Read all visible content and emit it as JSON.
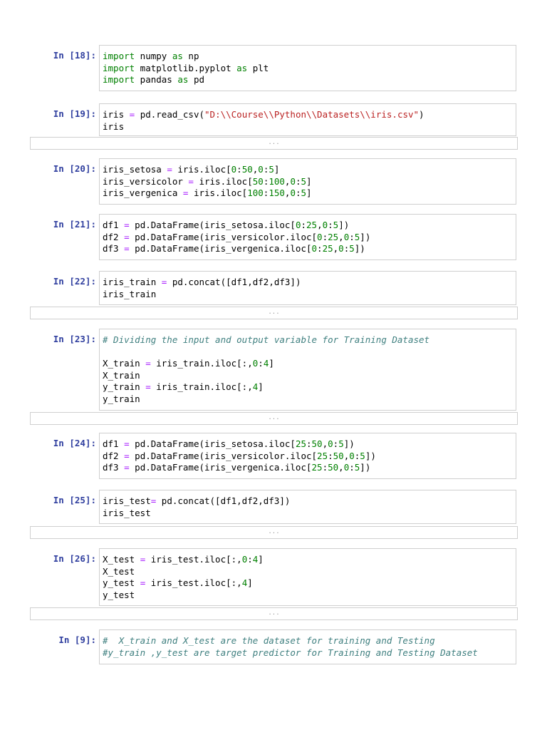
{
  "cells": [
    {
      "prompt": "In [18]:",
      "lines": [
        [
          [
            "import",
            "k"
          ],
          [
            " numpy ",
            ""
          ],
          [
            "as",
            "k"
          ],
          [
            " np",
            ""
          ]
        ],
        [
          [
            "import",
            "k"
          ],
          [
            " matplotlib.pyplot ",
            ""
          ],
          [
            "as",
            "k"
          ],
          [
            " plt",
            ""
          ]
        ],
        [
          [
            "import",
            "k"
          ],
          [
            " pandas ",
            ""
          ],
          [
            "as",
            "k"
          ],
          [
            " pd",
            ""
          ]
        ]
      ],
      "output": null
    },
    {
      "prompt": "In [19]:",
      "lines": [
        [
          [
            "iris ",
            ""
          ],
          [
            "=",
            "o"
          ],
          [
            " pd.read_csv(",
            ""
          ],
          [
            "\"D:\\\\Course\\\\Python\\\\Datasets\\\\iris.csv\"",
            "s"
          ],
          [
            ")",
            ""
          ]
        ],
        [
          [
            "iris",
            ""
          ]
        ]
      ],
      "output": "..."
    },
    {
      "prompt": "In [20]:",
      "lines": [
        [
          [
            "iris_setosa ",
            ""
          ],
          [
            "=",
            "o"
          ],
          [
            " iris.iloc[",
            ""
          ],
          [
            "0",
            "n"
          ],
          [
            ":",
            ""
          ],
          [
            "50",
            "n"
          ],
          [
            ",",
            ""
          ],
          [
            "0",
            "n"
          ],
          [
            ":",
            ""
          ],
          [
            "5",
            "n"
          ],
          [
            "]",
            ""
          ]
        ],
        [
          [
            "iris_versicolor ",
            ""
          ],
          [
            "=",
            "o"
          ],
          [
            " iris.iloc[",
            ""
          ],
          [
            "50",
            "n"
          ],
          [
            ":",
            ""
          ],
          [
            "100",
            "n"
          ],
          [
            ",",
            ""
          ],
          [
            "0",
            "n"
          ],
          [
            ":",
            ""
          ],
          [
            "5",
            "n"
          ],
          [
            "]",
            ""
          ]
        ],
        [
          [
            "iris_vergenica ",
            ""
          ],
          [
            "=",
            "o"
          ],
          [
            " iris.iloc[",
            ""
          ],
          [
            "100",
            "n"
          ],
          [
            ":",
            ""
          ],
          [
            "150",
            "n"
          ],
          [
            ",",
            ""
          ],
          [
            "0",
            "n"
          ],
          [
            ":",
            ""
          ],
          [
            "5",
            "n"
          ],
          [
            "]",
            ""
          ]
        ]
      ],
      "output": null
    },
    {
      "prompt": "In [21]:",
      "lines": [
        [
          [
            "df1 ",
            ""
          ],
          [
            "=",
            "o"
          ],
          [
            " pd.DataFrame(iris_setosa.iloc[",
            ""
          ],
          [
            "0",
            "n"
          ],
          [
            ":",
            ""
          ],
          [
            "25",
            "n"
          ],
          [
            ",",
            ""
          ],
          [
            "0",
            "n"
          ],
          [
            ":",
            ""
          ],
          [
            "5",
            "n"
          ],
          [
            "])",
            ""
          ]
        ],
        [
          [
            "df2 ",
            ""
          ],
          [
            "=",
            "o"
          ],
          [
            " pd.DataFrame(iris_versicolor.iloc[",
            ""
          ],
          [
            "0",
            "n"
          ],
          [
            ":",
            ""
          ],
          [
            "25",
            "n"
          ],
          [
            ",",
            ""
          ],
          [
            "0",
            "n"
          ],
          [
            ":",
            ""
          ],
          [
            "5",
            "n"
          ],
          [
            "])",
            ""
          ]
        ],
        [
          [
            "df3 ",
            ""
          ],
          [
            "=",
            "o"
          ],
          [
            " pd.DataFrame(iris_vergenica.iloc[",
            ""
          ],
          [
            "0",
            "n"
          ],
          [
            ":",
            ""
          ],
          [
            "25",
            "n"
          ],
          [
            ",",
            ""
          ],
          [
            "0",
            "n"
          ],
          [
            ":",
            ""
          ],
          [
            "5",
            "n"
          ],
          [
            "])",
            ""
          ]
        ]
      ],
      "output": null
    },
    {
      "prompt": "In [22]:",
      "lines": [
        [
          [
            "iris_train ",
            ""
          ],
          [
            "=",
            "o"
          ],
          [
            " pd.concat([df1,df2,df3])",
            ""
          ]
        ],
        [
          [
            "iris_train",
            ""
          ]
        ]
      ],
      "output": "..."
    },
    {
      "prompt": "In [23]:",
      "lines": [
        [
          [
            "# Dividing the input and output variable for Training Dataset",
            "c"
          ]
        ],
        [],
        [
          [
            "X_train ",
            ""
          ],
          [
            "=",
            "o"
          ],
          [
            " iris_train.iloc[:,",
            ""
          ],
          [
            "0",
            "n"
          ],
          [
            ":",
            ""
          ],
          [
            "4",
            "n"
          ],
          [
            "]",
            ""
          ]
        ],
        [
          [
            "X_train",
            ""
          ]
        ],
        [
          [
            "y_train ",
            ""
          ],
          [
            "=",
            "o"
          ],
          [
            " iris_train.iloc[:,",
            ""
          ],
          [
            "4",
            "n"
          ],
          [
            "]",
            ""
          ]
        ],
        [
          [
            "y_train",
            ""
          ]
        ]
      ],
      "output": "..."
    },
    {
      "prompt": "In [24]:",
      "lines": [
        [
          [
            "df1 ",
            ""
          ],
          [
            "=",
            "o"
          ],
          [
            " pd.DataFrame(iris_setosa.iloc[",
            ""
          ],
          [
            "25",
            "n"
          ],
          [
            ":",
            ""
          ],
          [
            "50",
            "n"
          ],
          [
            ",",
            ""
          ],
          [
            "0",
            "n"
          ],
          [
            ":",
            ""
          ],
          [
            "5",
            "n"
          ],
          [
            "])",
            ""
          ]
        ],
        [
          [
            "df2 ",
            ""
          ],
          [
            "=",
            "o"
          ],
          [
            " pd.DataFrame(iris_versicolor.iloc[",
            ""
          ],
          [
            "25",
            "n"
          ],
          [
            ":",
            ""
          ],
          [
            "50",
            "n"
          ],
          [
            ",",
            ""
          ],
          [
            "0",
            "n"
          ],
          [
            ":",
            ""
          ],
          [
            "5",
            "n"
          ],
          [
            "])",
            ""
          ]
        ],
        [
          [
            "df3 ",
            ""
          ],
          [
            "=",
            "o"
          ],
          [
            " pd.DataFrame(iris_vergenica.iloc[",
            ""
          ],
          [
            "25",
            "n"
          ],
          [
            ":",
            ""
          ],
          [
            "50",
            "n"
          ],
          [
            ",",
            ""
          ],
          [
            "0",
            "n"
          ],
          [
            ":",
            ""
          ],
          [
            "5",
            "n"
          ],
          [
            "])",
            ""
          ]
        ]
      ],
      "output": null
    },
    {
      "prompt": "In [25]:",
      "lines": [
        [
          [
            "iris_test",
            ""
          ],
          [
            "=",
            "o"
          ],
          [
            " pd.concat([df1,df2,df3])",
            ""
          ]
        ],
        [
          [
            "iris_test",
            ""
          ]
        ]
      ],
      "output": "..."
    },
    {
      "prompt": "In [26]:",
      "lines": [
        [
          [
            "X_test ",
            ""
          ],
          [
            "=",
            "o"
          ],
          [
            " iris_test.iloc[:,",
            ""
          ],
          [
            "0",
            "n"
          ],
          [
            ":",
            ""
          ],
          [
            "4",
            "n"
          ],
          [
            "]",
            ""
          ]
        ],
        [
          [
            "X_test",
            ""
          ]
        ],
        [
          [
            "y_test ",
            ""
          ],
          [
            "=",
            "o"
          ],
          [
            " iris_test.iloc[:,",
            ""
          ],
          [
            "4",
            "n"
          ],
          [
            "]",
            ""
          ]
        ],
        [
          [
            "y_test",
            ""
          ]
        ]
      ],
      "output": "..."
    },
    {
      "prompt": "In [9]:",
      "lines": [
        [
          [
            "#  X_train and X_test are the dataset for training and Testing",
            "c"
          ]
        ],
        [
          [
            "#y_train ,y_test are target predictor for Training and Testing Dataset",
            "c"
          ]
        ]
      ],
      "output": null
    }
  ]
}
